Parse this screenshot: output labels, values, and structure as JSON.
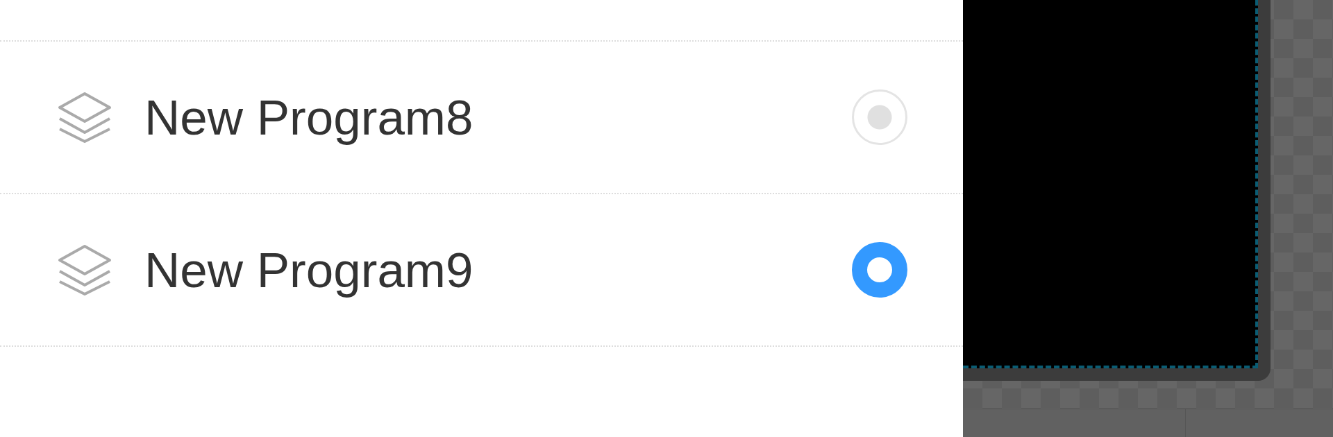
{
  "programs": [
    {
      "name": "New Program8",
      "selected": false
    },
    {
      "name": "New Program9",
      "selected": true
    }
  ]
}
